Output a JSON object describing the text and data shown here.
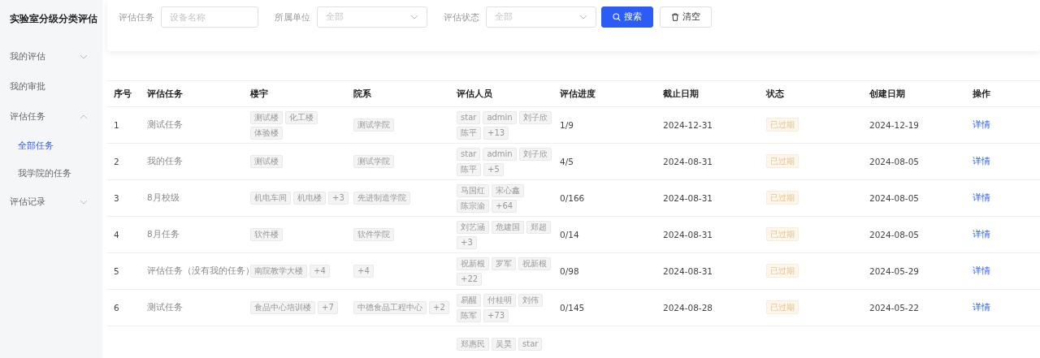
{
  "sidebar": {
    "title": "实验室分级分类评估",
    "items": [
      {
        "label": "我的评估",
        "expanded": false,
        "selected": false
      },
      {
        "label": "我的审批",
        "selected": false
      },
      {
        "label": "评估任务",
        "expanded": true,
        "selected": false,
        "children": [
          {
            "label": "全部任务",
            "selected": true
          },
          {
            "label": "我学院的任务",
            "selected": false
          }
        ]
      },
      {
        "label": "评估记录",
        "expanded": false,
        "selected": false
      }
    ]
  },
  "filters": [
    {
      "kind": "input",
      "label": "评估任务",
      "placeholder": "设备名称"
    },
    {
      "kind": "select",
      "label": "所属单位",
      "placeholder": "全部"
    },
    {
      "kind": "select",
      "label": "评估状态",
      "placeholder": "全部"
    }
  ],
  "buttons": [
    {
      "kind": "primary",
      "label": "搜索"
    },
    {
      "kind": "plain",
      "label": "清空"
    }
  ],
  "table": {
    "columns": [
      "序号",
      "评估任务",
      "楼宇",
      "院系",
      "评估人员",
      "评估进度",
      "截止日期",
      "状态",
      "创建日期",
      "操作"
    ],
    "rows": [
      {
        "index": "1",
        "task": "测试任务",
        "buildings": [
          "测试楼",
          "化工楼",
          "体验楼"
        ],
        "departments": [
          "测试学院"
        ],
        "evaluators": [
          "star",
          "admin",
          "刘子欣",
          "陈平",
          "+13"
        ],
        "progress": "1/9",
        "deadline": "2024-12-31",
        "status": {
          "kind": "expired",
          "text": "已过期"
        },
        "created": "2024-12-19",
        "action": "详情"
      },
      {
        "index": "2",
        "task": "我的任务",
        "buildings": [
          "测试楼"
        ],
        "departments": [
          "测试学院"
        ],
        "evaluators": [
          "star",
          "admin",
          "刘子欣",
          "陈平",
          "+5"
        ],
        "progress": "4/5",
        "deadline": "2024-08-31",
        "status": {
          "kind": "expired",
          "text": "已过期"
        },
        "created": "2024-08-05",
        "action": "详情"
      },
      {
        "index": "3",
        "task": "8月校级",
        "buildings": [
          "机电车间",
          "机电楼",
          "+3"
        ],
        "departments": [
          "先进制造学院"
        ],
        "evaluators": [
          "马国红",
          "宋心鑫",
          "陈宗渝",
          "+64"
        ],
        "progress": "0/166",
        "deadline": "2024-08-31",
        "status": {
          "kind": "expired",
          "text": "已过期"
        },
        "created": "2024-08-05",
        "action": "详情"
      },
      {
        "index": "4",
        "task": "8月任务",
        "buildings": [
          "软件楼"
        ],
        "departments": [
          "软件学院"
        ],
        "evaluators": [
          "刘艺涵",
          "危建国",
          "郑超",
          "+3"
        ],
        "progress": "0/14",
        "deadline": "2024-08-31",
        "status": {
          "kind": "expired",
          "text": "已过期"
        },
        "created": "2024-08-05",
        "action": "详情"
      },
      {
        "index": "5",
        "task": "评估任务（没有我的任务）",
        "buildings": [
          "南院教学大楼",
          "+4"
        ],
        "departments": [
          "+4"
        ],
        "evaluators": [
          "祝新根",
          "罗军",
          "祝新根",
          "+22"
        ],
        "progress": "0/98",
        "deadline": "2024-08-31",
        "status": {
          "kind": "expired",
          "text": "已过期"
        },
        "created": "2024-05-29",
        "action": "详情"
      },
      {
        "index": "6",
        "task": "测试任务",
        "buildings": [
          "食品中心培训楼",
          "+7"
        ],
        "departments": [
          "中德食品工程中心",
          "+2"
        ],
        "evaluators": [
          "易醒",
          "付桂明",
          "刘伟",
          "陈军",
          "+73"
        ],
        "progress": "0/145",
        "deadline": "2024-08-28",
        "status": {
          "kind": "expired",
          "text": "已过期"
        },
        "created": "2024-05-22",
        "action": "详情"
      },
      {
        "evaluators": [
          "郑惠民",
          "吴昊",
          "star"
        ]
      }
    ]
  }
}
